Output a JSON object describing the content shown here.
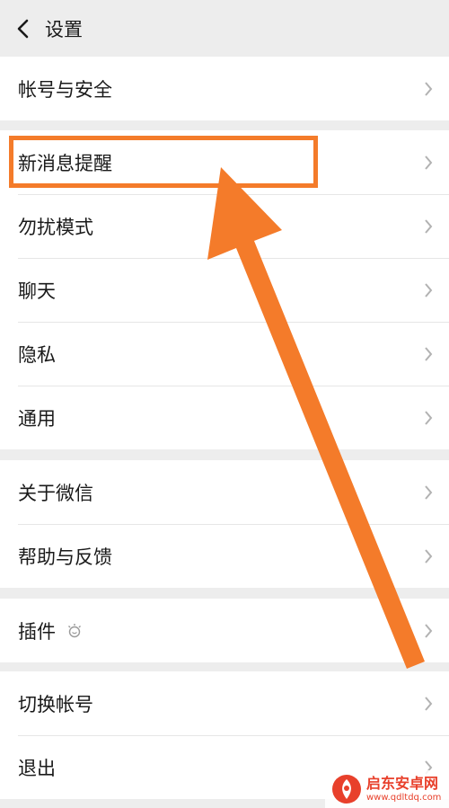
{
  "header": {
    "title": "设置"
  },
  "groups": [
    {
      "items": [
        {
          "label": "帐号与安全"
        }
      ]
    },
    {
      "items": [
        {
          "label": "新消息提醒"
        },
        {
          "label": "勿扰模式"
        },
        {
          "label": "聊天"
        },
        {
          "label": "隐私"
        },
        {
          "label": "通用"
        }
      ]
    },
    {
      "items": [
        {
          "label": "关于微信"
        },
        {
          "label": "帮助与反馈"
        }
      ]
    },
    {
      "items": [
        {
          "label": "插件",
          "icon": "plugin-icon"
        }
      ]
    },
    {
      "items": [
        {
          "label": "切换帐号"
        },
        {
          "label": "退出"
        }
      ]
    }
  ],
  "annotation": {
    "highlight_item": "新消息提醒",
    "color": "#f47b2a"
  },
  "watermark": {
    "name": "启东安卓网",
    "url": "www.qdltdq.com",
    "color": "#e8402b"
  },
  "colors": {
    "background": "#ededed",
    "card": "#ffffff",
    "text": "#1a1a1a",
    "chevron": "#b2b2b2"
  }
}
